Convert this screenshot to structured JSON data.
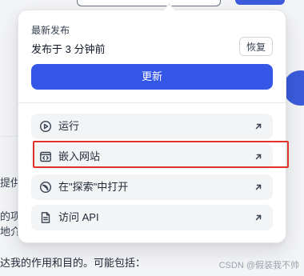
{
  "background": {
    "text_line_1": "提供",
    "text_line_2": "的项",
    "text_line_3": "地介",
    "bottom_text": "达我的作用和目的。可能包括：",
    "watermark": "CSDN @假装我不帅"
  },
  "popover": {
    "section_title": "最新发布",
    "published_time": "发布于 3 分钟前",
    "restore_label": "恢复",
    "update_label": "更新",
    "menu": [
      {
        "label": "运行",
        "icon": "play-circle-icon"
      },
      {
        "label": "嵌入网站",
        "icon": "embed-window-icon"
      },
      {
        "label": "在\"探索\"中打开",
        "icon": "explore-compass-icon"
      },
      {
        "label": "访问 API",
        "icon": "document-api-icon"
      }
    ]
  },
  "colors": {
    "accent": "#3457e8",
    "highlight": "#e0342b"
  }
}
